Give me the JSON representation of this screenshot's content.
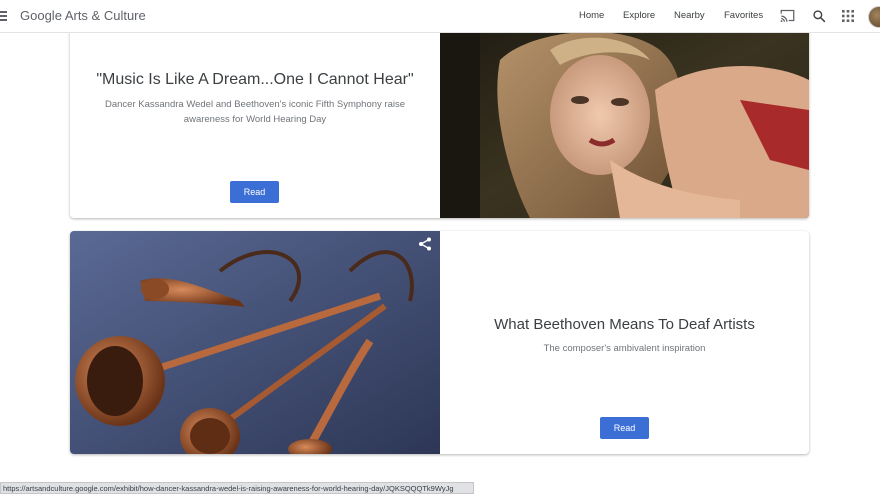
{
  "header": {
    "brand": "Google Arts & Culture",
    "nav": [
      "Home",
      "Explore",
      "Nearby",
      "Favorites"
    ],
    "icons": [
      "menu-icon",
      "cast-icon",
      "search-icon",
      "apps-icon"
    ]
  },
  "cards": [
    {
      "title": "\"Music Is Like A Dream...One I Cannot Hear\"",
      "description": "Dancer Kassandra Wedel and Beethoven's iconic Fifth Symphony raise awareness for World Hearing Day",
      "button": "Read",
      "image": "dancer-photo"
    },
    {
      "title": "What Beethoven Means To Deaf Artists",
      "description": "The composer's ambivalent inspiration",
      "button": "Read",
      "image": "ear-trumpets-photo"
    }
  ],
  "status_url": "https://artsandculture.google.com/exhibit/how-dancer-kassandra-wedel-is-raising-awareness-for-world-hearing-day/JQKSQQQTk9WyJg",
  "colors": {
    "accent": "#3b6fd6",
    "text": "#3c4043",
    "muted": "#70757a"
  }
}
